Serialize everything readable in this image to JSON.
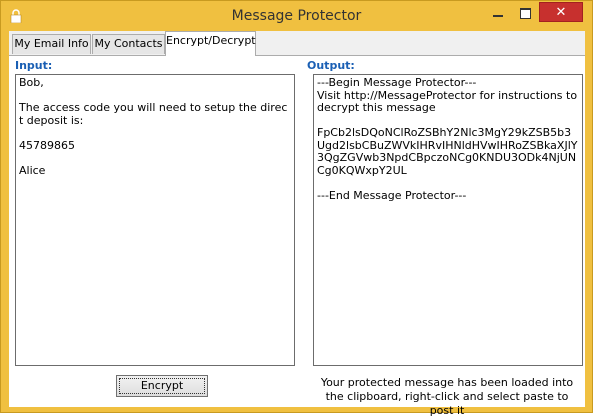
{
  "window": {
    "title": "Message Protector",
    "close_glyph": "✕"
  },
  "tabs": [
    {
      "label": "My Email Info"
    },
    {
      "label": "My Contacts"
    },
    {
      "label": "Encrypt/Decrypt"
    }
  ],
  "input": {
    "label": "Input:",
    "value": "Bob,\n\nThe access code you will need to setup the direct deposit is:\n\n45789865\n\nAlice"
  },
  "output": {
    "label": "Output:",
    "value": "---Begin Message Protector---\nVisit http://MessageProtector for instructions to decrypt this message\n\nFpCb2lsDQoNClRoZSBhY2Nlc3MgY29kZSB5b3Ugd2lsbCBuZWVkIHRvIHNldHVwIHRoZSBkaXJlY3QgZGVwb3NpdCBpczoNCg0KNDU3ODk4NjUNCg0KQWxpY2UL\n\n---End Message Protector---"
  },
  "encrypt_button": {
    "label": "Encrypt"
  },
  "status_message": "Your protected message has been loaded into the clipboard, right-click and select paste to post it",
  "icons": {
    "app": "lock-icon",
    "minimize": "minimize-icon",
    "maximize": "maximize-icon",
    "close": "close-icon"
  },
  "colors": {
    "frame": "#f0c040",
    "label": "#1a5fb4",
    "close": "#c7302e"
  }
}
